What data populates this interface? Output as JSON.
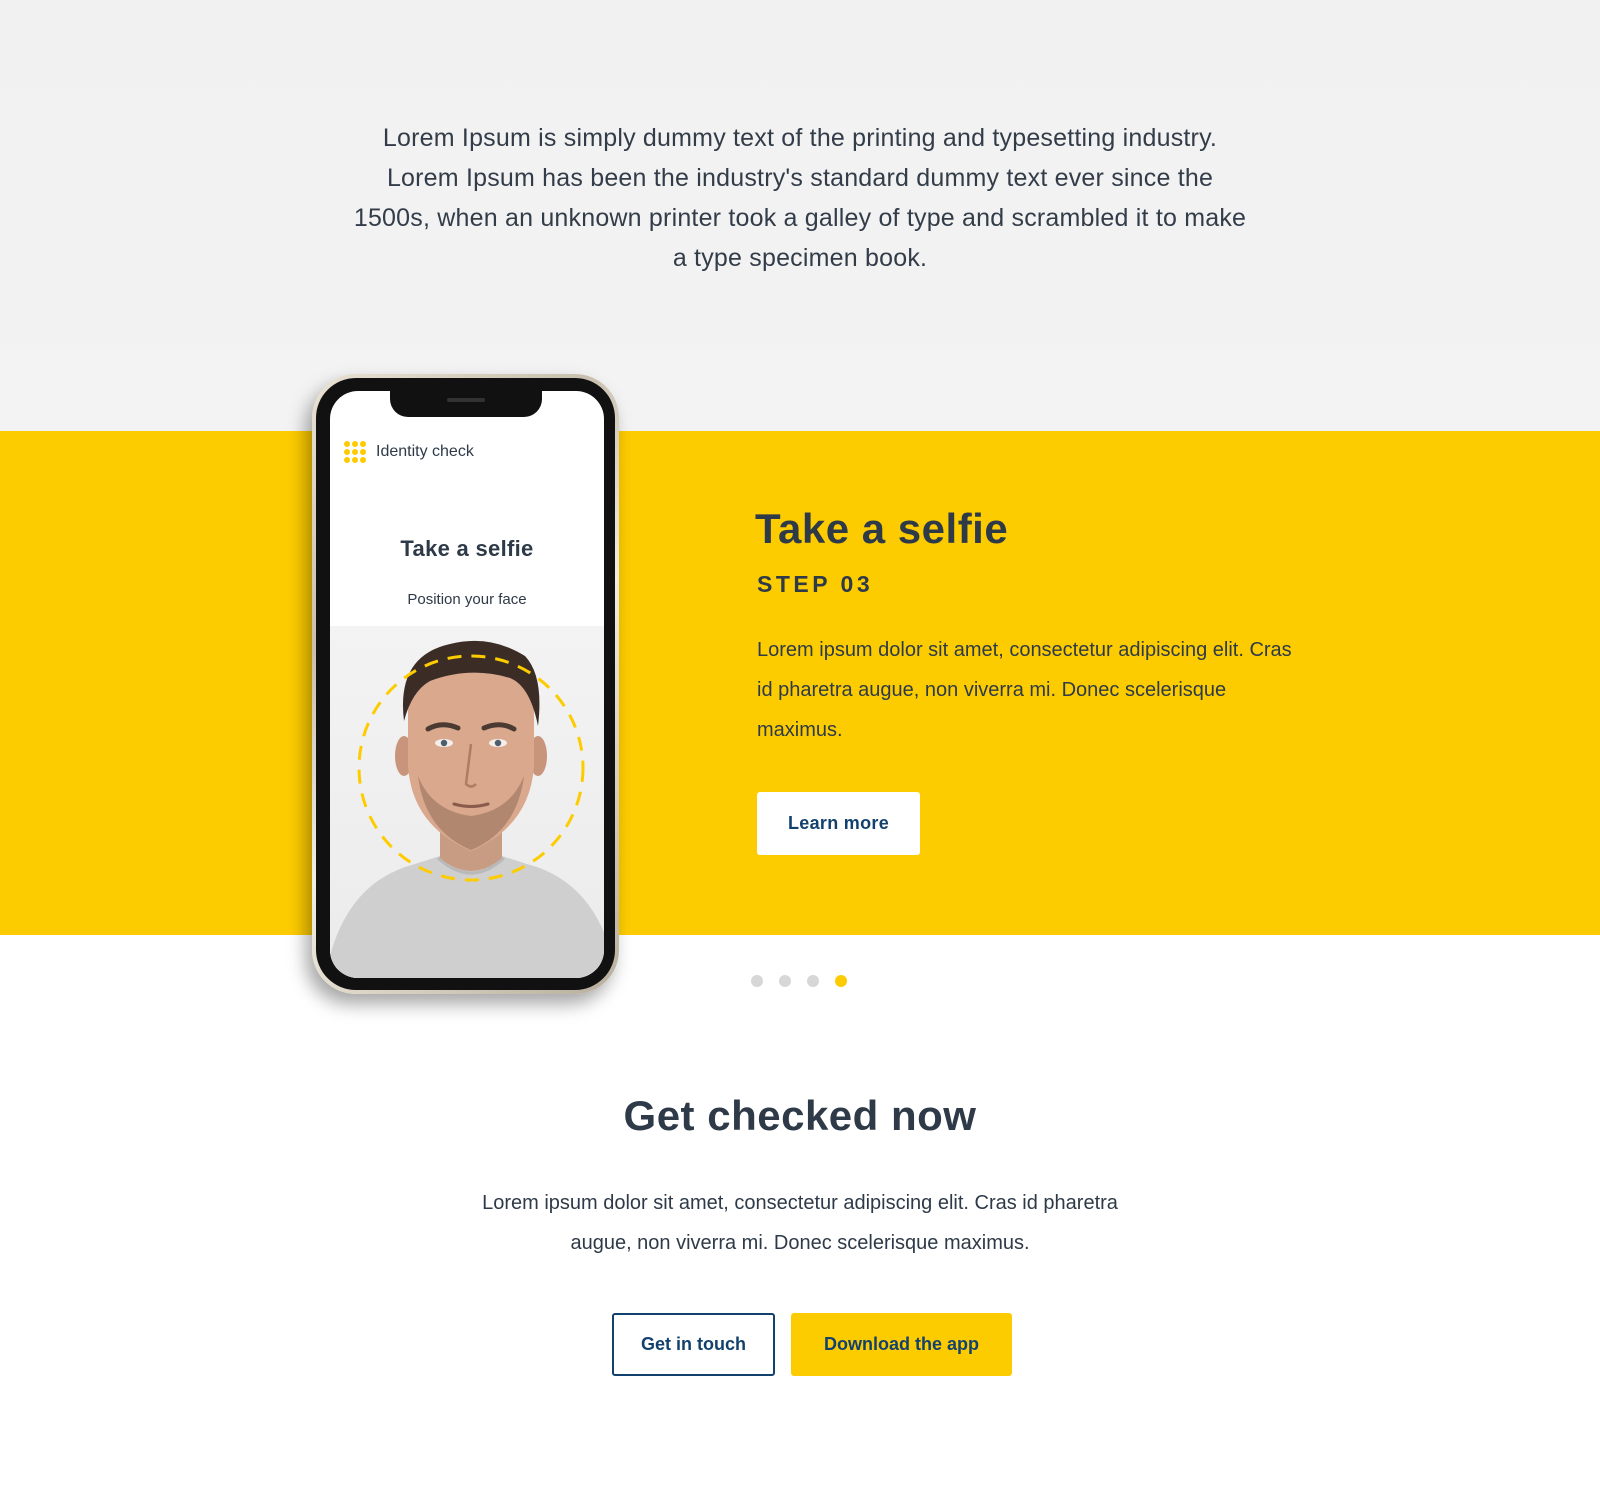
{
  "intro": {
    "text": "Lorem Ipsum is simply dummy text of the printing and typesetting industry. Lorem Ipsum has been the industry's standard dummy text ever since the 1500s, when an unknown printer took a galley of type and scrambled it to make a type specimen book."
  },
  "phone": {
    "app_title": "Identity check",
    "heading": "Take a selfie",
    "subheading": "Position your face",
    "logo_icon": "dot-grid-icon"
  },
  "step": {
    "title": "Take a selfie",
    "label": "STEP 03",
    "description": "Lorem ipsum dolor sit amet, consectetur adipiscing elit. Cras id pharetra augue, non viverra mi. Donec scelerisque maximus.",
    "button_label": "Learn more"
  },
  "carousel": {
    "total": 4,
    "active_index": 3
  },
  "cta": {
    "title": "Get checked now",
    "description": "Lorem ipsum dolor sit amet, consectetur adipiscing elit. Cras id pharetra augue, non viverra mi. Donec scelerisque maximus.",
    "secondary_button": "Get in touch",
    "primary_button": "Download the app"
  },
  "colors": {
    "accent_yellow": "#fdcc00",
    "navy": "#13416e",
    "text_dark": "#2e3a48",
    "light_gray_bg": "#f2f2f2"
  }
}
